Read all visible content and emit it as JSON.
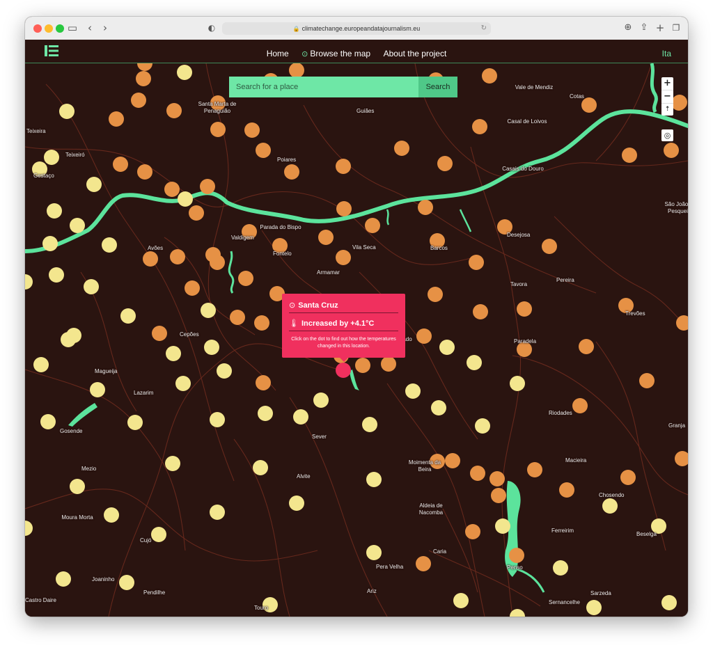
{
  "browser": {
    "url": "climatechange.europeandatajournalism.eu",
    "icons": {
      "sidebar": "sidebar-icon",
      "back": "chevron-left-icon",
      "forward": "chevron-right-icon",
      "shield": "shield-icon",
      "download": "download-icon",
      "share": "share-icon",
      "new_tab": "plus-icon",
      "tabs": "tabs-icon",
      "reload": "reload-icon",
      "lock": "lock-icon"
    }
  },
  "nav": {
    "links": [
      "Home",
      "Browse the map",
      "About the project"
    ],
    "language": "Ita"
  },
  "search": {
    "placeholder": "Search for a place",
    "button": "Search"
  },
  "map": {
    "controls": {
      "zoom_in": "+",
      "zoom_out": "−"
    },
    "colors": {
      "background": "#2a1410",
      "river": "#5ce39c",
      "road": "#6b2a1e",
      "warmer_dot": "#e69145",
      "cooler_dot": "#f3e68e",
      "selected_dot": "#f0305e"
    },
    "places": [
      "Teixeira",
      "Teixeiró",
      "Gestaço",
      "Santa Marta de Penaguião",
      "Guiães",
      "Poiares",
      "Vale de Mendiz",
      "Cotas",
      "Casal de Loivos",
      "Casais do Douro",
      "Valdigem",
      "Parada do Bispo",
      "Fontelo",
      "Vila Seca",
      "Barcos",
      "Desejosa",
      "São João da Pesqueira",
      "Avões",
      "Armamar",
      "Pereira",
      "Tavora",
      "Trevões",
      "Santa Cruz",
      "São Cosmado",
      "Paradela",
      "Magueija",
      "Cepões",
      "Lazarim",
      "Gosende",
      "Sever",
      "Riodades",
      "Granja",
      "Mezio",
      "Alvite",
      "Moimenta da Beira",
      "Macieira",
      "Chosendo",
      "Aldeia de Nacomba",
      "Ferreirim",
      "Beselga",
      "Moura Morta",
      "Cujó",
      "Joaninho",
      "Pera Velha",
      "Caria",
      "Penso",
      "Sarzeda",
      "Sernancelhe",
      "Ariz",
      "Castro Daire",
      "Touro",
      "Pendilhe"
    ]
  },
  "tooltip": {
    "place": "Santa Cruz",
    "value": "Increased by +4.1°C",
    "hint": "Click on the dot to find out how the temperatures changed in this location."
  }
}
